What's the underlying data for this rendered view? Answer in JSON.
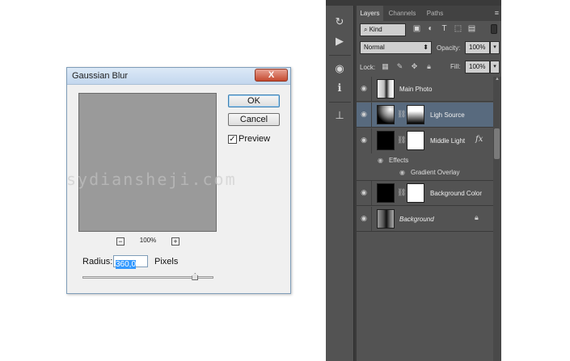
{
  "dialog": {
    "title": "Gaussian Blur",
    "close_glyph": "X",
    "ok_label": "OK",
    "cancel_label": "Cancel",
    "preview_label": "Preview",
    "preview_checked": true,
    "zoom_out_glyph": "−",
    "zoom_in_glyph": "+",
    "zoom_level": "100%",
    "radius_label": "Radius:",
    "radius_value": "360,0",
    "radius_unit": "Pixels",
    "radius_slider_fraction": 0.86
  },
  "watermark": "sydiansheji.com",
  "tools": [
    {
      "icon": "history-icon",
      "glyph": "↻"
    },
    {
      "icon": "play-icon",
      "glyph": "▶"
    },
    {
      "icon": "adjustments-icon",
      "glyph": "◉"
    },
    {
      "icon": "info-icon",
      "glyph": "ℹ"
    },
    {
      "icon": "clone-source-icon",
      "glyph": "⊥"
    }
  ],
  "panel": {
    "tabs": [
      "Layers",
      "Channels",
      "Paths"
    ],
    "menu_glyph": "≡",
    "kind_label": "⌕ Kind",
    "blend_mode": "Normal",
    "opacity_label": "Opacity:",
    "opacity_value": "100%",
    "lock_label": "Lock:",
    "fill_label": "Fill:",
    "fill_value": "100%",
    "dropdown_glyph": "▾"
  },
  "layers": [
    {
      "name": "Main Photo",
      "selected": false,
      "thumb": "photo",
      "mask": false,
      "fx": false,
      "locked": false,
      "italic": false
    },
    {
      "name": "Ligh Source",
      "selected": true,
      "thumb": "gradient",
      "mask": "gradient",
      "fx": false,
      "locked": false,
      "italic": false
    },
    {
      "name": "Middle Light",
      "selected": false,
      "thumb": "black",
      "mask": "white",
      "fx": true,
      "locked": false,
      "italic": false
    },
    {
      "name": "Background Color",
      "selected": false,
      "thumb": "black",
      "mask": "white",
      "fx": false,
      "locked": false,
      "italic": false
    },
    {
      "name": "Background",
      "selected": false,
      "thumb": "photo",
      "mask": false,
      "fx": false,
      "locked": true,
      "italic": true
    }
  ],
  "effects": {
    "header": "Effects",
    "items": [
      "Gradient Overlay"
    ]
  },
  "colors": {
    "selected_layer": "#586a7e",
    "panel_bg": "#535353",
    "highlight": "#3399ff"
  }
}
